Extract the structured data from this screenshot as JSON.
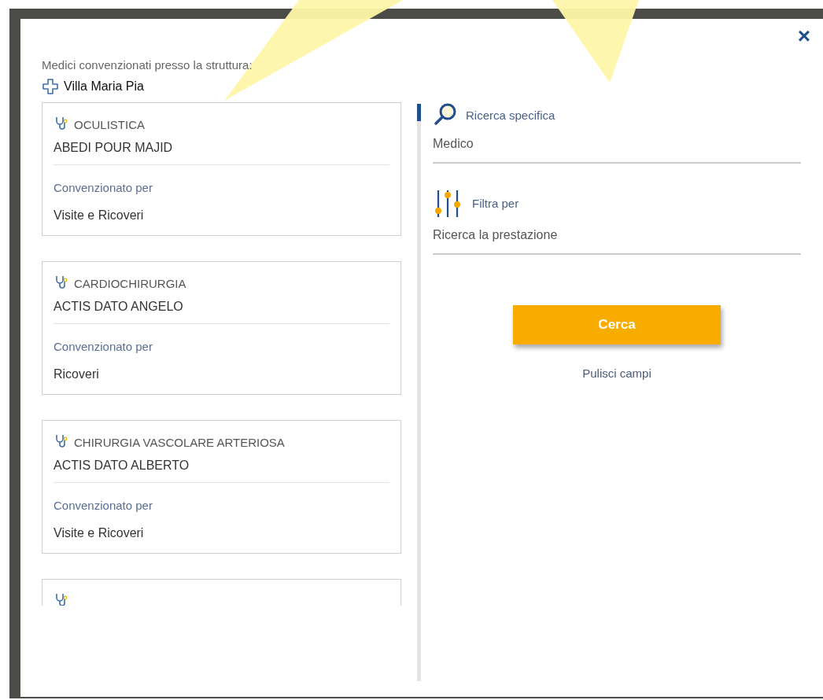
{
  "dialog": {
    "close": "×",
    "heading": "Medici convenzionati presso la struttura:",
    "facility": "Villa Maria Pia"
  },
  "doctors": [
    {
      "kind": "full",
      "specialty": "OCULISTICA",
      "name": "ABEDI POUR MAJID",
      "label": "Convenzionato per",
      "coverage": "Visite e Ricoveri"
    },
    {
      "kind": "full",
      "specialty": "CARDIOCHIRURGIA",
      "name": "ACTIS DATO ANGELO",
      "label": "Convenzionato per",
      "coverage": "Ricoveri"
    },
    {
      "kind": "full",
      "specialty": "CHIRURGIA VASCOLARE ARTERIOSA",
      "name": "ACTIS DATO ALBERTO",
      "label": "Convenzionato per",
      "coverage": "Visite e Ricoveri"
    },
    {
      "kind": "cut-off"
    }
  ],
  "search": {
    "title": "Ricerca specifica",
    "doctor_field": {
      "placeholder": "Medico"
    },
    "filter_title": "Filtra per",
    "service_field": {
      "placeholder": "Ricerca la prestazione"
    },
    "submit": "Cerca",
    "clear": "Pulisci campi"
  }
}
